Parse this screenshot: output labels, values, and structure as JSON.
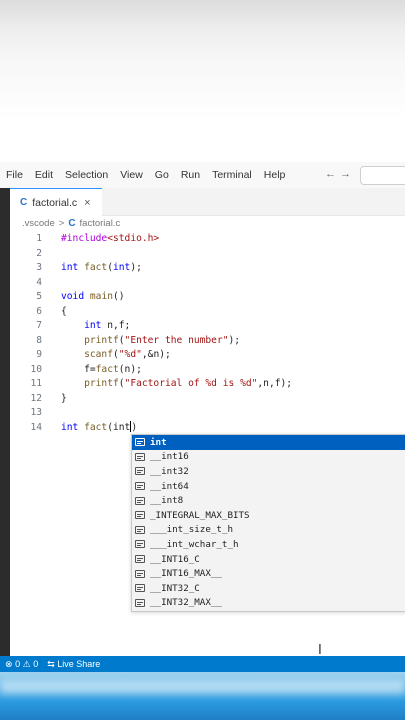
{
  "menu": [
    "File",
    "Edit",
    "Selection",
    "View",
    "Go",
    "Run",
    "Terminal",
    "Help"
  ],
  "nav": {
    "back": "←",
    "forward": "→"
  },
  "tab": {
    "icon": "C",
    "label": "factorial.c",
    "close": "×"
  },
  "breadcrumb": {
    "folder": ".vscode",
    "sep": ">",
    "icon": "C",
    "file": "factorial.c"
  },
  "lines": [
    {
      "n": "1",
      "html": "<span class=\"pp\">#include</span><span class=\"s\">&lt;stdio.h&gt;</span>"
    },
    {
      "n": "2",
      "html": ""
    },
    {
      "n": "3",
      "html": "<span class=\"ty\">int</span> <span class=\"fn\">fact</span>(<span class=\"ty\">int</span>);"
    },
    {
      "n": "4",
      "html": ""
    },
    {
      "n": "5",
      "html": "<span class=\"ty\">void</span> <span class=\"fn\">main</span>()"
    },
    {
      "n": "6",
      "html": "{"
    },
    {
      "n": "7",
      "html": "    <span class=\"ty\">int</span> n,f;"
    },
    {
      "n": "8",
      "html": "    <span class=\"fn\">printf</span>(<span class=\"s\">\"Enter the number\"</span>);"
    },
    {
      "n": "9",
      "html": "    <span class=\"fn\">scanf</span>(<span class=\"s\">\"%d\"</span>,&amp;n);"
    },
    {
      "n": "10",
      "html": "    f=<span class=\"fn\">fact</span>(n);"
    },
    {
      "n": "11",
      "html": "    <span class=\"fn\">printf</span>(<span class=\"s\">\"Factorial of %d is %d\"</span>,n,f);"
    },
    {
      "n": "12",
      "html": "}"
    },
    {
      "n": "13",
      "html": ""
    },
    {
      "n": "14",
      "html": "<span class=\"ty\">int</span> <span class=\"fn\">fact</span>(int<span class=\"cursor\"></span>)"
    }
  ],
  "suggestions": [
    "int",
    "__int16",
    "__int32",
    "__int64",
    "__int8",
    "_INTEGRAL_MAX_BITS",
    "___int_size_t_h",
    "___int_wchar_t_h",
    "__INT16_C",
    "__INT16_MAX__",
    "__INT32_C",
    "__INT32_MAX__"
  ],
  "status": {
    "errors": "0",
    "warnings": "0",
    "live_share": "Live Share"
  },
  "colors": {
    "statusbar": "#007acc",
    "selected": "#0060c0",
    "tab_border": "#3794ff"
  }
}
